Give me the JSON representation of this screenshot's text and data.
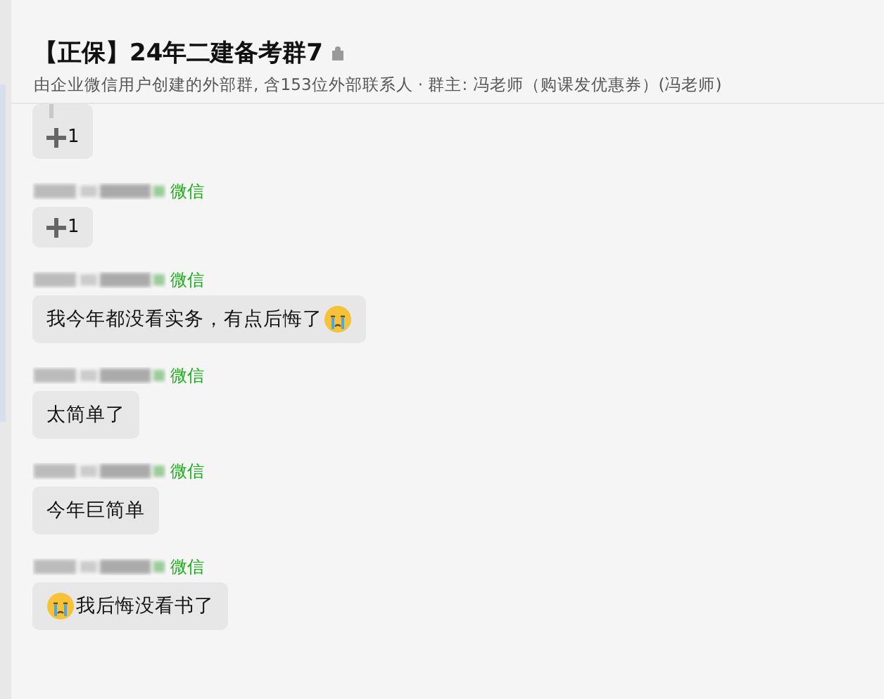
{
  "header": {
    "title": "【正保】24年二建备考群7",
    "subtitle": "由企业微信用户创建的外部群, 含153位外部联系人 · 群主: 冯老师（购课发优惠券）(冯老师)"
  },
  "messages": [
    {
      "kind": "reaction",
      "quoted": true,
      "count": "1"
    },
    {
      "kind": "reaction",
      "source": "微信",
      "count": "1"
    },
    {
      "kind": "text",
      "source": "微信",
      "text": "我今年都没看实务，有点后悔了",
      "emoji_after": true
    },
    {
      "kind": "text",
      "source": "微信",
      "text": "太简单了"
    },
    {
      "kind": "text",
      "source": "微信",
      "text": "今年巨简单"
    },
    {
      "kind": "text",
      "source": "微信",
      "text": "我后悔没看书了",
      "emoji_before": true
    }
  ]
}
